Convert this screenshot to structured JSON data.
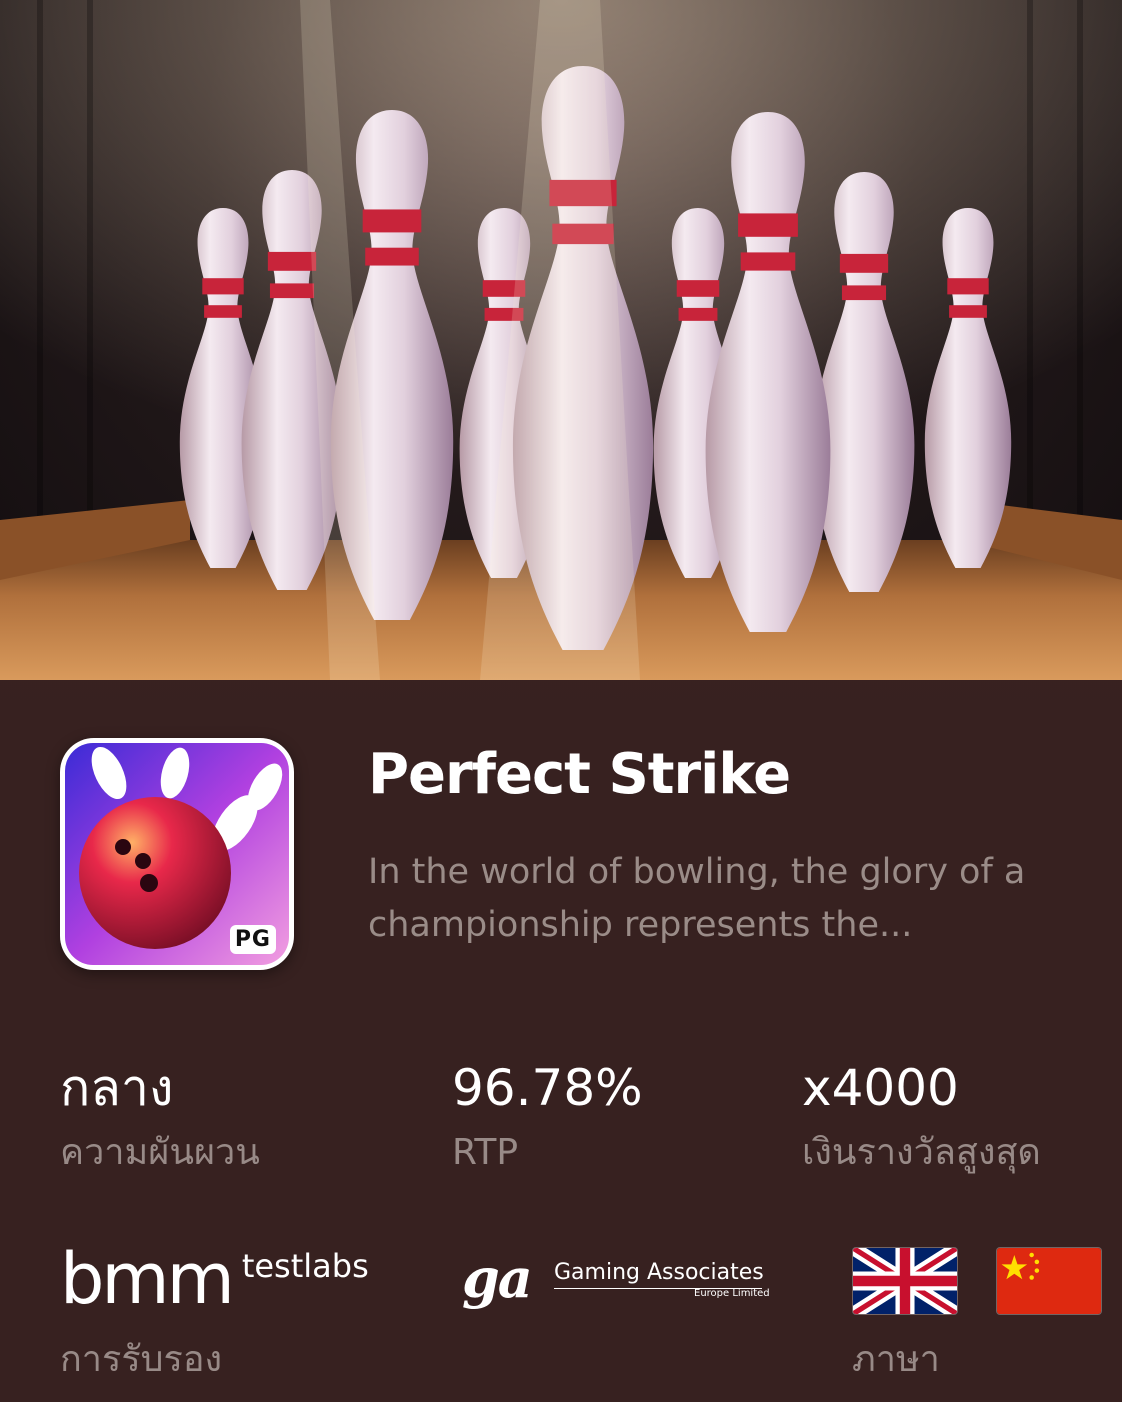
{
  "game": {
    "title": "Perfect Strike",
    "description": "In the world of bowling, the glory of a championship represents the...",
    "icon_badge": "PG"
  },
  "stats": [
    {
      "value": "กลาง",
      "label": "ความผันผวน"
    },
    {
      "value": "96.78%",
      "label": "RTP"
    },
    {
      "value": "x4000",
      "label": "เงินรางวัลสูงสุด"
    }
  ],
  "certification": {
    "bmm_main": "bmm",
    "bmm_sub": "testlabs",
    "ga_mark": "ga",
    "ga_name": "Gaming Associates",
    "ga_sub": "Europe Limited",
    "label": "การรับรอง"
  },
  "languages": {
    "flags": [
      "uk-flag-icon",
      "china-flag-icon"
    ],
    "label": "ภาษา"
  },
  "colors": {
    "background": "#3a2220",
    "muted_text": "#988a87",
    "pin_stripe": "#c8243a"
  }
}
